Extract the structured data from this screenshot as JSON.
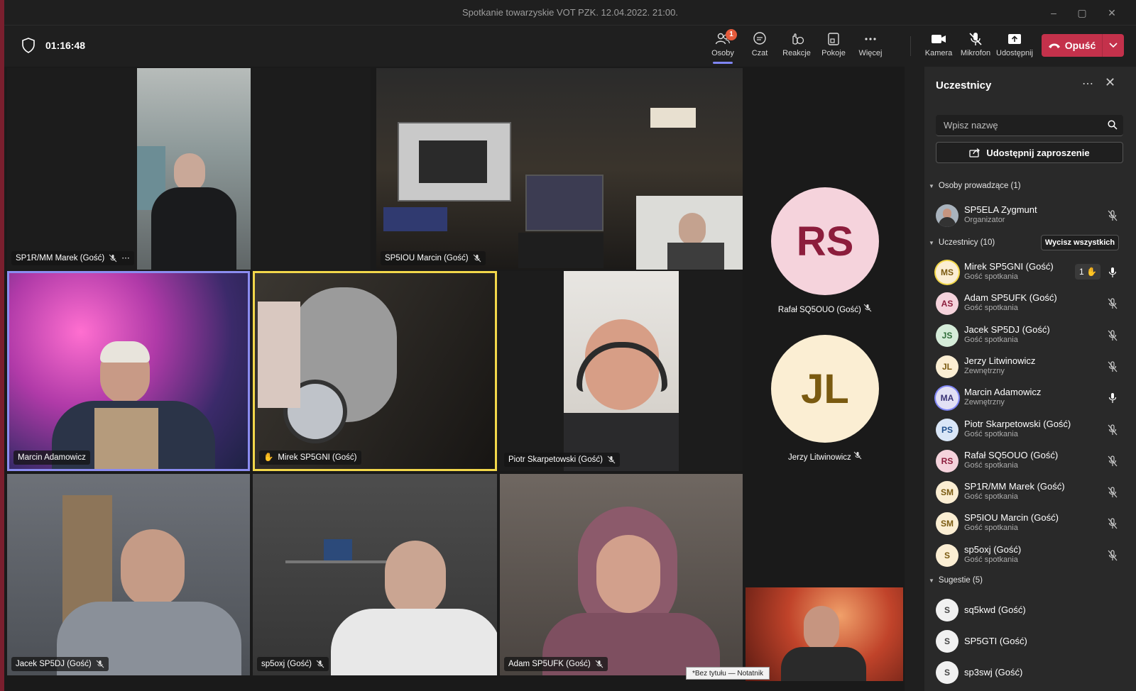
{
  "window": {
    "title": "Spotkanie towarzyskie VOT PZK. 12.04.2022. 21:00.",
    "controls": [
      "minimize-icon",
      "maximize-icon",
      "close-icon"
    ]
  },
  "toolbar": {
    "timer": "01:16:48",
    "buttons": [
      {
        "label": "Osoby",
        "icon": "people-icon",
        "badge": "1",
        "active": true
      },
      {
        "label": "Czat",
        "icon": "chat-icon"
      },
      {
        "label": "Reakcje",
        "icon": "reactions-icon"
      },
      {
        "label": "Pokoje",
        "icon": "rooms-icon"
      },
      {
        "label": "Więcej",
        "icon": "more-icon"
      },
      {
        "label": "Kamera",
        "icon": "camera-icon"
      },
      {
        "label": "Mikrofon",
        "icon": "microphone-off-icon"
      },
      {
        "label": "Udostępnij",
        "icon": "share-icon"
      }
    ],
    "leave_label": "Opuść"
  },
  "stage": {
    "tiles": [
      {
        "name": "SP1R/MM Marek (Gość)",
        "muted": true,
        "more": "⋯"
      },
      {
        "name": "SP5IOU Marcin (Gość)",
        "muted": true
      },
      {
        "name": "Marcin Adamowicz",
        "muted": false
      },
      {
        "name": "Mirek SP5GNI (Gość)",
        "muted": false,
        "raised_hand": true
      },
      {
        "name": "Piotr Skarpetowski (Gość)",
        "muted": true
      },
      {
        "name": "Jacek SP5DJ (Gość)",
        "muted": true
      },
      {
        "name": "sp5oxj (Gość)",
        "muted": true
      },
      {
        "name": "Adam SP5UFK (Gość)",
        "muted": true
      }
    ],
    "avatar_tiles": [
      {
        "initials": "RS",
        "name": "Rafał SQ5OUO (Gość)",
        "bg": "#f5d3dc",
        "fg": "#8c1d3c"
      },
      {
        "initials": "JL",
        "name": "Jerzy Litwinowicz",
        "bg": "#fbeed3",
        "fg": "#7a5a10"
      }
    ],
    "taskbar_tooltip": "*Bez tytułu — Notatnik"
  },
  "participants_panel": {
    "title": "Uczestnicy",
    "more": "⋯",
    "close": "✕",
    "search_placeholder": "Wpisz nazwę",
    "invite_label": "Udostępnij zaproszenie",
    "presenters_header": "Osoby prowadzące (1)",
    "presenters": [
      {
        "name": "SP5ELA Zygmunt",
        "role": "Organizator",
        "muted": true
      }
    ],
    "attendees_header": "Uczestnicy (10)",
    "remove_all_label": "Wycisz wszystkich",
    "attendees": [
      {
        "initials": "MS",
        "name": "Mirek SP5GNI (Gość)",
        "role": "Gość spotkania",
        "muted": false,
        "hand_count": "1",
        "bg": "#fbeed3",
        "fg": "#7a5a10"
      },
      {
        "initials": "AS",
        "name": "Adam SP5UFK (Gość)",
        "role": "Gość spotkania",
        "muted": true,
        "bg": "#f5d3dc",
        "fg": "#8c1d3c"
      },
      {
        "initials": "JS",
        "name": "Jacek SP5DJ (Gość)",
        "role": "Gość spotkania",
        "muted": true,
        "bg": "#d5ecd9",
        "fg": "#2d6b37"
      },
      {
        "initials": "JL",
        "name": "Jerzy Litwinowicz",
        "role": "Zewnętrzny",
        "muted": true,
        "bg": "#fbeed3",
        "fg": "#7a5a10"
      },
      {
        "initials": "MA",
        "name": "Marcin Adamowicz",
        "role": "Zewnętrzny",
        "muted": false,
        "bg": "#e2e0f5",
        "fg": "#3b3477"
      },
      {
        "initials": "PS",
        "name": "Piotr Skarpetowski (Gość)",
        "role": "Gość spotkania",
        "muted": true,
        "bg": "#d9e6f7",
        "fg": "#1f4f8c"
      },
      {
        "initials": "RS",
        "name": "Rafał SQ5OUO (Gość)",
        "role": "Gość spotkania",
        "muted": true,
        "bg": "#f5d3dc",
        "fg": "#8c1d3c"
      },
      {
        "initials": "SM",
        "name": "SP1R/MM Marek (Gość)",
        "role": "Gość spotkania",
        "muted": true,
        "bg": "#fbeed3",
        "fg": "#7a5a10"
      },
      {
        "initials": "SM",
        "name": "SP5IOU Marcin (Gość)",
        "role": "Gość spotkania",
        "muted": true,
        "bg": "#fbeed3",
        "fg": "#7a5a10"
      },
      {
        "initials": "S",
        "name": "sp5oxj (Gość)",
        "role": "Gość spotkania",
        "muted": true,
        "bg": "#fbeed3",
        "fg": "#7a5a10"
      }
    ],
    "suggestions_header": "Sugestie (5)",
    "suggestions": [
      {
        "initials": "S",
        "name": "sq5kwd (Gość)"
      },
      {
        "initials": "S",
        "name": "SP5GTI (Gość)"
      },
      {
        "initials": "S",
        "name": "sp3swj (Gość)"
      }
    ]
  }
}
